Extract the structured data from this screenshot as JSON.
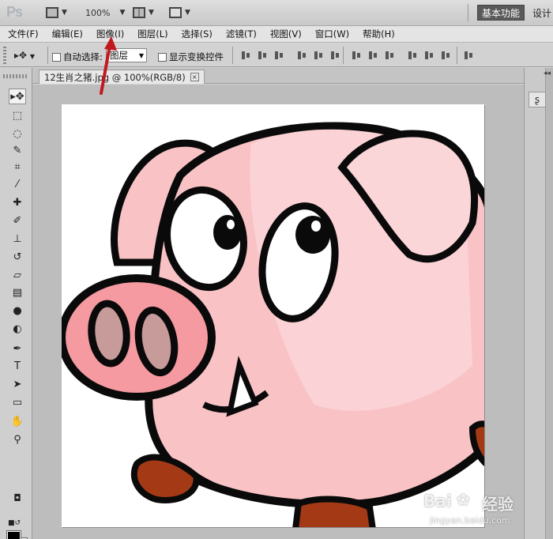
{
  "app": {
    "logo": "Ps",
    "zoom_label": "100%",
    "workspace_label": "基本功能",
    "design_label": "设计"
  },
  "menu": [
    "文件(F)",
    "编辑(E)",
    "图像(I)",
    "图层(L)",
    "选择(S)",
    "滤镜(T)",
    "视图(V)",
    "窗口(W)",
    "帮助(H)"
  ],
  "options": {
    "auto_select_label": "自动选择:",
    "layer_select_value": "图层",
    "show_transform_label": "显示变换控件"
  },
  "document": {
    "tab_title": "12生肖之猪.jpg @ 100%(RGB/8)",
    "close_glyph": "×"
  },
  "tools": [
    {
      "name": "move-tool",
      "glyph": "▸✥"
    },
    {
      "name": "marquee-tool",
      "glyph": "⬚"
    },
    {
      "name": "lasso-tool",
      "glyph": "◌"
    },
    {
      "name": "quick-select-tool",
      "glyph": "✎"
    },
    {
      "name": "crop-tool",
      "glyph": "⌗"
    },
    {
      "name": "eyedropper-tool",
      "glyph": "⁄"
    },
    {
      "name": "healing-brush-tool",
      "glyph": "✚"
    },
    {
      "name": "brush-tool",
      "glyph": "✐"
    },
    {
      "name": "clone-stamp-tool",
      "glyph": "⊥"
    },
    {
      "name": "history-brush-tool",
      "glyph": "↺"
    },
    {
      "name": "eraser-tool",
      "glyph": "▱"
    },
    {
      "name": "gradient-tool",
      "glyph": "▤"
    },
    {
      "name": "blur-tool",
      "glyph": "●"
    },
    {
      "name": "dodge-tool",
      "glyph": "◐"
    },
    {
      "name": "pen-tool",
      "glyph": "✒"
    },
    {
      "name": "type-tool",
      "glyph": "T"
    },
    {
      "name": "path-select-tool",
      "glyph": "➤"
    },
    {
      "name": "shape-tool",
      "glyph": "▭"
    },
    {
      "name": "hand-tool",
      "glyph": "✋"
    },
    {
      "name": "zoom-tool",
      "glyph": "⚲"
    }
  ],
  "toolbar_extra": {
    "mini_swatch": "■↺",
    "quick_mask": "◘"
  },
  "right_panel": {
    "collapse": "◂◂",
    "panel_icon": "ʂ"
  },
  "watermark": {
    "brand": "Bai",
    "brand_cn": "经验",
    "url": "jingyan.baidu.com"
  },
  "colors": {
    "pig_body": "#f9c3c6",
    "pig_snout": "#f59aa0",
    "nostril": "#c79b9a",
    "hoof": "#a33a15",
    "outline": "#0a0a0a",
    "arrow": "#c0181d"
  }
}
